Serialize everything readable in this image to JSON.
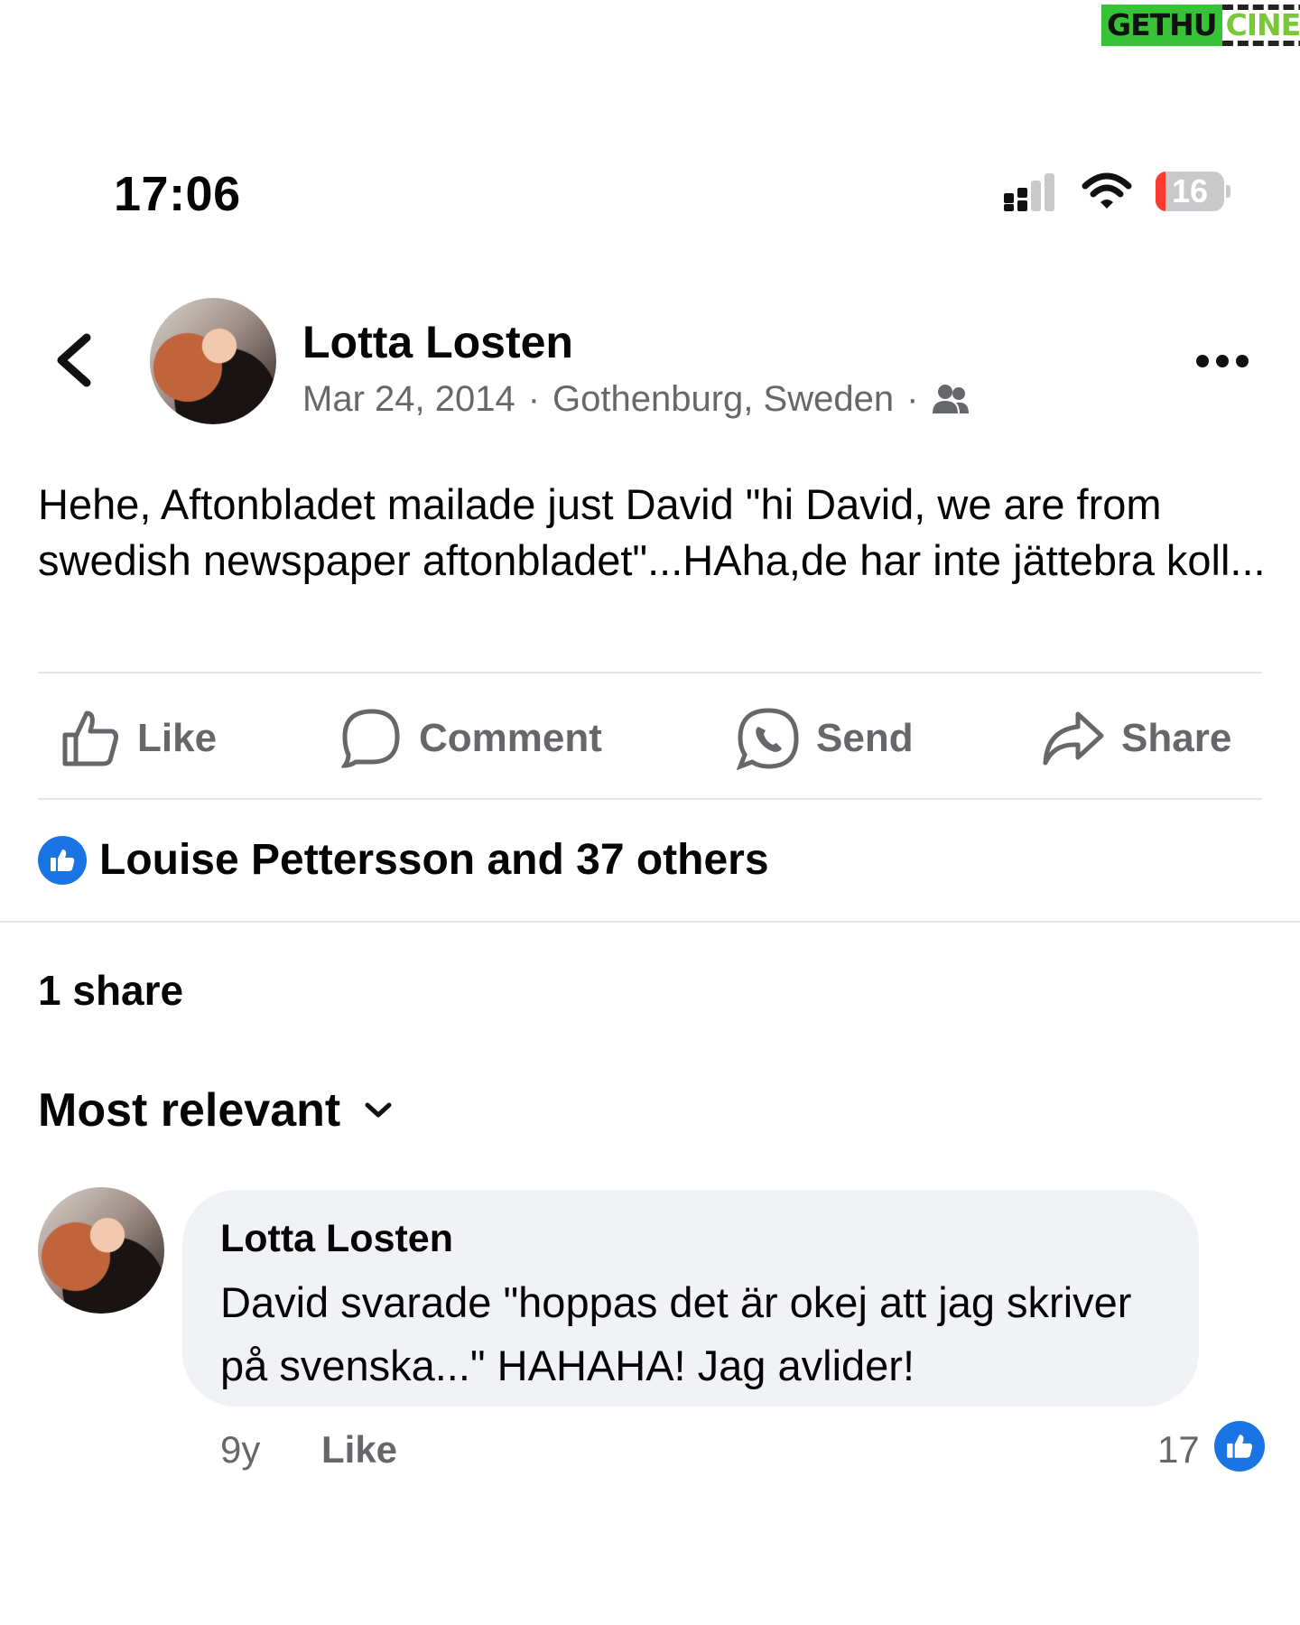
{
  "watermark": {
    "part1": "GETHU",
    "part2": "CINEMA"
  },
  "status_bar": {
    "time": "17:06",
    "battery": "16"
  },
  "post": {
    "author": "Lotta Losten",
    "date": "Mar 24, 2014",
    "location": "Gothenburg, Sweden",
    "separator": "·",
    "audience_icon": "friends-icon",
    "text": "Hehe, Aftonbladet mailade just David \"hi David, we are from swedish newspaper aftonbladet\"...HAha,de har inte jättebra koll..."
  },
  "actions": {
    "like": "Like",
    "comment": "Comment",
    "send": "Send",
    "share": "Share"
  },
  "reactions": {
    "summary": "Louise Pettersson and 37 others"
  },
  "shares": {
    "label": "1 share"
  },
  "sort": {
    "label": "Most relevant"
  },
  "comment": {
    "author": "Lotta Losten",
    "text": "David svarade \"hoppas det är okej att jag skriver på svenska...\" HAHAHA! Jag avlider!",
    "age": "9y",
    "like_label": "Like",
    "like_count": "17"
  },
  "colors": {
    "accent": "#1b74e4",
    "muted": "#65676b",
    "bubble": "#f0f2f5",
    "battery_low": "#ff3b30"
  }
}
